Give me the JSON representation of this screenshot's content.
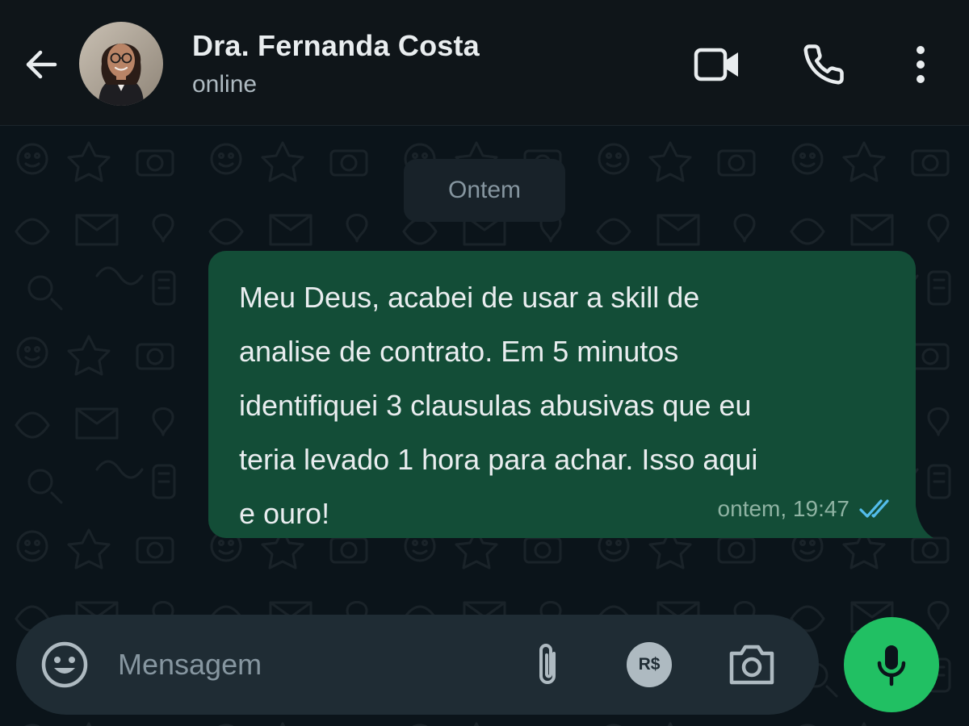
{
  "header": {
    "contact_name": "Dra. Fernanda Costa",
    "status": "online",
    "icons": {
      "back": "arrow-left-icon",
      "video": "video-camera-icon",
      "call": "phone-icon",
      "menu": "more-vertical-icon"
    }
  },
  "chat": {
    "date_separator": "Ontem",
    "messages": [
      {
        "direction": "outgoing",
        "text": "Meu Deus, acabei de usar a skill de\nanalise de contrato. Em 5 minutos\nidentifiquei 3 clausulas abusivas que eu\nteria levado 1 hora para achar. Isso aqui\ne ouro!",
        "time": "ontem, 19:47",
        "status": "read"
      }
    ]
  },
  "composer": {
    "placeholder": "Mensagem",
    "value": "",
    "payment_label": "R$",
    "icons": {
      "emoji": "smiley-icon",
      "attach": "paperclip-icon",
      "payment": "payment-icon",
      "camera": "camera-icon",
      "mic": "microphone-icon"
    }
  },
  "colors": {
    "background": "#0b141a",
    "header": "#0f1519",
    "outgoing_bubble": "#134d37",
    "composer": "#1f2c34",
    "accent_green": "#21c063",
    "read_tick": "#53bdeb"
  }
}
